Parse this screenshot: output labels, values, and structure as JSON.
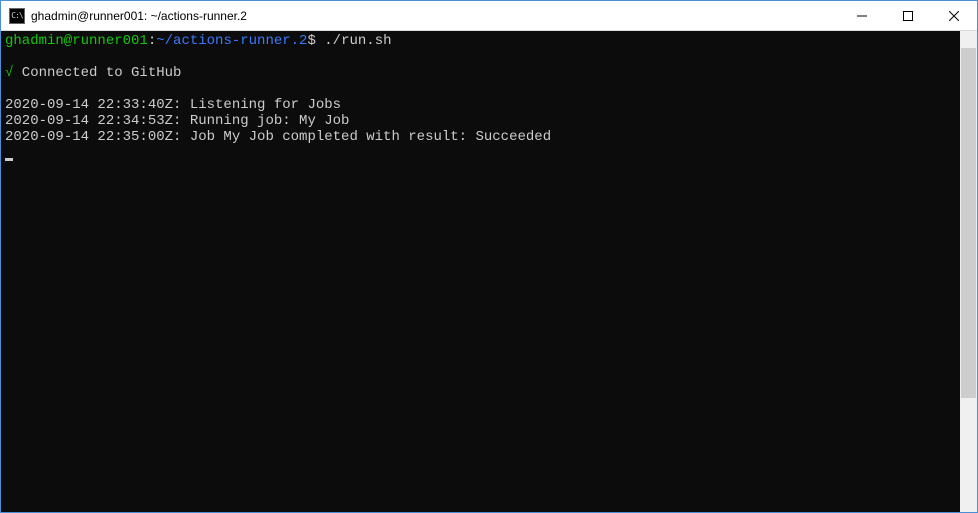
{
  "titlebar": {
    "icon_text": "C:\\",
    "title": "ghadmin@runner001: ~/actions-runner.2"
  },
  "prompt": {
    "user_host": "ghadmin@runner001",
    "separator1": ":",
    "path": "~/actions-runner.2",
    "separator2": "$",
    "command": "./run.sh"
  },
  "output": {
    "check": "√",
    "connected": " Connected to GitHub",
    "line1": "2020-09-14 22:33:40Z: Listening for Jobs",
    "line2": "2020-09-14 22:34:53Z: Running job: My Job",
    "line3": "2020-09-14 22:35:00Z: Job My Job completed with result: Succeeded"
  }
}
